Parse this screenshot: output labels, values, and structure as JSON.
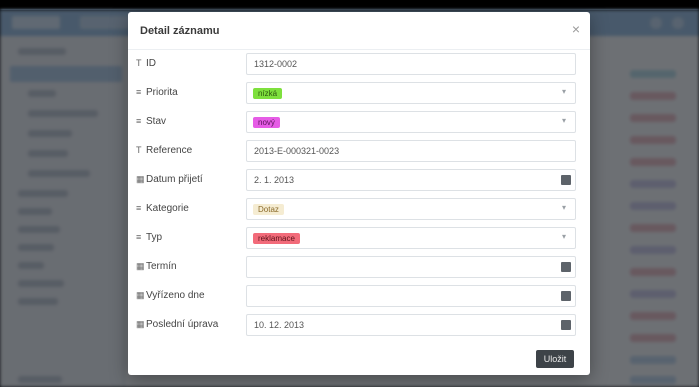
{
  "modal": {
    "title": "Detail záznamu",
    "close_icon": "×",
    "submit_label": "Uložit"
  },
  "fields": [
    {
      "label": "ID",
      "mark": "T",
      "type": "text",
      "value": "1312-0002"
    },
    {
      "label": "Priorita",
      "mark": "≡",
      "type": "chip",
      "value": "nízká",
      "chip_bg": "#7ee03d",
      "chip_fg": "#2f5b10"
    },
    {
      "label": "Stav",
      "mark": "≡",
      "type": "chip",
      "value": "nový",
      "chip_bg": "#e65ce6",
      "chip_fg": "#5a145a"
    },
    {
      "label": "Reference",
      "mark": "T",
      "type": "text",
      "value": "2013-E-000321-0023"
    },
    {
      "label": "Datum přijetí",
      "mark": "▦",
      "type": "date",
      "value": "2. 1. 2013"
    },
    {
      "label": "Kategorie",
      "mark": "≡",
      "type": "chip",
      "value": "Dotaz",
      "chip_bg": "#f5ecd2",
      "chip_fg": "#8a6a2a"
    },
    {
      "label": "Typ",
      "mark": "≡",
      "type": "chip",
      "value": "reklamace",
      "chip_bg": "#f26b7a",
      "chip_fg": "#5c1119"
    },
    {
      "label": "Termín",
      "mark": "▦",
      "type": "date",
      "value": ""
    },
    {
      "label": "Vyřízeno dne",
      "mark": "▦",
      "type": "date",
      "value": ""
    },
    {
      "label": "Poslední úprava",
      "mark": "▦",
      "type": "date",
      "value": "10. 12. 2013"
    }
  ],
  "icons": {
    "caret": "▾"
  },
  "colors": {
    "overlay": "rgba(20,24,30,0.62)",
    "header": "#9fc3e6",
    "submit": "#3d4348"
  }
}
